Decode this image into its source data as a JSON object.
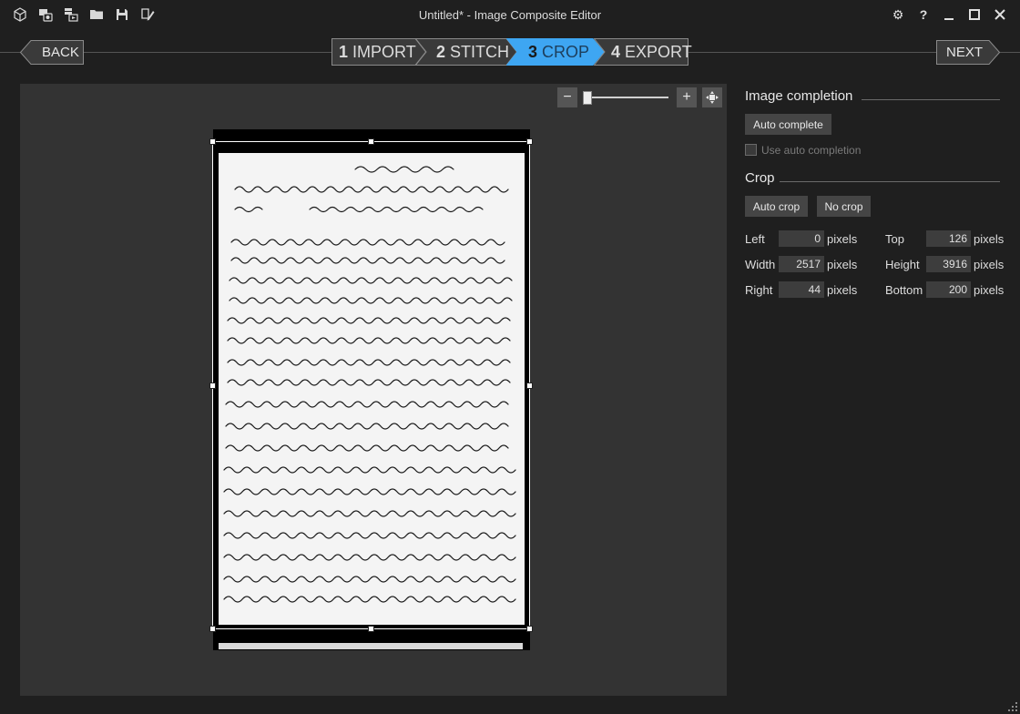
{
  "window": {
    "title": "Untitled* - Image Composite Editor"
  },
  "toolbar": {
    "icons": [
      "new-project-icon",
      "new-panorama-from-images-icon",
      "new-panorama-from-video-icon",
      "open-project-icon",
      "save-project-icon",
      "save-project-as-icon"
    ]
  },
  "window_controls": {
    "settings": "⚙",
    "help": "?",
    "minimize": "—",
    "maximize": "☐",
    "close": "✕"
  },
  "nav": {
    "back": "BACK",
    "next": "NEXT",
    "steps": [
      {
        "num": "1",
        "label": "IMPORT"
      },
      {
        "num": "2",
        "label": "STITCH"
      },
      {
        "num": "3",
        "label": "CROP",
        "active": true
      },
      {
        "num": "4",
        "label": "EXPORT"
      }
    ],
    "accent": "#3ea6f2"
  },
  "zoom": {
    "minus": "−",
    "plus": "+",
    "level": 0.05
  },
  "panel": {
    "image_completion": {
      "title": "Image completion",
      "auto_complete": "Auto complete",
      "use_auto_completion": "Use auto completion"
    },
    "crop": {
      "title": "Crop",
      "auto_crop": "Auto crop",
      "no_crop": "No crop",
      "unit": "pixels",
      "left_label": "Left",
      "left_value": "0",
      "top_label": "Top",
      "top_value": "126",
      "width_label": "Width",
      "width_value": "2517",
      "height_label": "Height",
      "height_value": "3916",
      "right_label": "Right",
      "right_value": "44",
      "bottom_label": "Bottom",
      "bottom_value": "200"
    }
  }
}
